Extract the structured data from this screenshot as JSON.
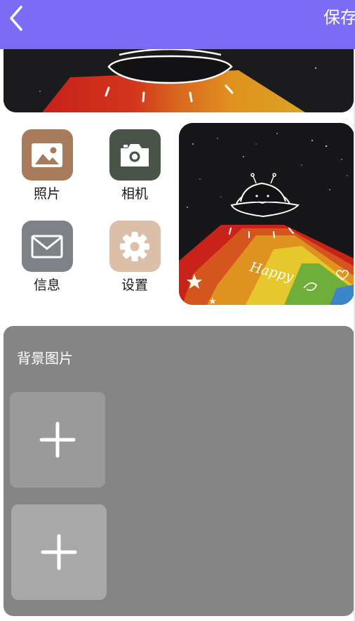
{
  "header": {
    "back_icon": "chevron-left-icon",
    "save_label": "保存"
  },
  "apps": [
    {
      "label": "照片",
      "icon": "image-icon",
      "color": "#a77b5c"
    },
    {
      "label": "相机",
      "icon": "camera-icon",
      "color": "#485448"
    },
    {
      "label": "信息",
      "icon": "mail-icon",
      "color": "#7e8185"
    },
    {
      "label": "设置",
      "icon": "gear-icon",
      "color": "#dcbfa8"
    }
  ],
  "preview": {
    "caption": "Happy"
  },
  "background_section": {
    "title": "背景图片",
    "slots": [
      {
        "icon": "plus-icon",
        "color": "#9a9a9a"
      },
      {
        "icon": "plus-icon",
        "color": "#a8a8a8"
      }
    ]
  },
  "colors": {
    "header": "#7b6cf6",
    "panel": "#858585"
  }
}
